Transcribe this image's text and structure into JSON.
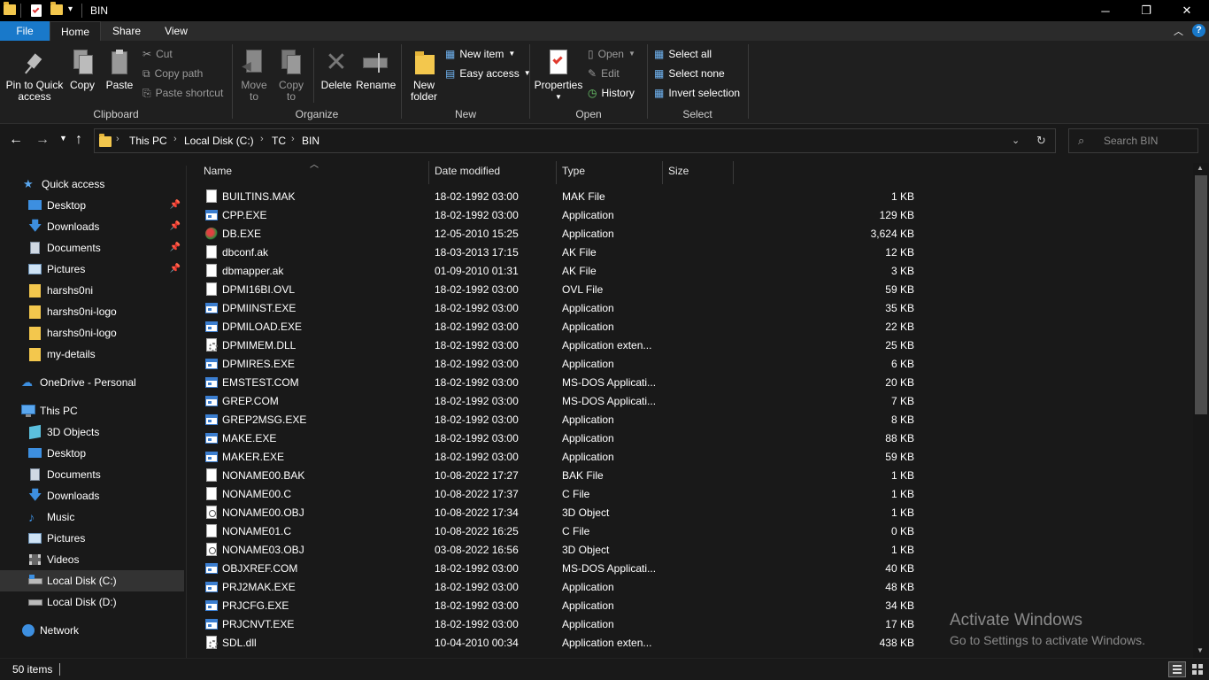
{
  "window": {
    "title": "BIN",
    "minimize": "─",
    "maximize": "❐",
    "close": "✕"
  },
  "ribbon_tabs": {
    "file": "File",
    "home": "Home",
    "share": "Share",
    "view": "View"
  },
  "ribbon": {
    "clipboard": {
      "group": "Clipboard",
      "pin_line1": "Pin to Quick",
      "pin_line2": "access",
      "copy": "Copy",
      "paste": "Paste",
      "cut": "Cut",
      "copy_path": "Copy path",
      "paste_shortcut": "Paste shortcut"
    },
    "organize": {
      "group": "Organize",
      "move_to_line1": "Move",
      "move_to_line2": "to",
      "copy_to_line1": "Copy",
      "copy_to_line2": "to",
      "delete": "Delete",
      "rename": "Rename"
    },
    "new": {
      "group": "New",
      "new_folder_line1": "New",
      "new_folder_line2": "folder",
      "new_item": "New item",
      "easy_access": "Easy access"
    },
    "open": {
      "group": "Open",
      "properties": "Properties",
      "open": "Open",
      "edit": "Edit",
      "history": "History"
    },
    "select": {
      "group": "Select",
      "select_all": "Select all",
      "select_none": "Select none",
      "invert_selection": "Invert selection"
    }
  },
  "address": {
    "crumbs": [
      "This PC",
      "Local Disk (C:)",
      "TC",
      "BIN"
    ],
    "search_placeholder": "Search BIN"
  },
  "sidebar": {
    "quick_access": "Quick access",
    "quick_items": [
      "Desktop",
      "Downloads",
      "Documents",
      "Pictures",
      "harshs0ni",
      "harshs0ni-logo",
      "harshs0ni-logo",
      "my-details"
    ],
    "onedrive": "OneDrive - Personal",
    "this_pc": "This PC",
    "pc_items": [
      "3D Objects",
      "Desktop",
      "Documents",
      "Downloads",
      "Music",
      "Pictures",
      "Videos",
      "Local Disk (C:)",
      "Local Disk (D:)"
    ],
    "network": "Network"
  },
  "columns": {
    "name": "Name",
    "date": "Date modified",
    "type": "Type",
    "size": "Size"
  },
  "files": [
    {
      "name": "BUILTINS.MAK",
      "date": "18-02-1992 03:00",
      "type": "MAK File",
      "size": "1 KB",
      "icon": "doc"
    },
    {
      "name": "CPP.EXE",
      "date": "18-02-1992 03:00",
      "type": "Application",
      "size": "129 KB",
      "icon": "app"
    },
    {
      "name": "DB.EXE",
      "date": "12-05-2010 15:25",
      "type": "Application",
      "size": "3,624 KB",
      "icon": "db"
    },
    {
      "name": "dbconf.ak",
      "date": "18-03-2013 17:15",
      "type": "AK File",
      "size": "12 KB",
      "icon": "doc"
    },
    {
      "name": "dbmapper.ak",
      "date": "01-09-2010 01:31",
      "type": "AK File",
      "size": "3 KB",
      "icon": "doc"
    },
    {
      "name": "DPMI16BI.OVL",
      "date": "18-02-1992 03:00",
      "type": "OVL File",
      "size": "59 KB",
      "icon": "doc"
    },
    {
      "name": "DPMIINST.EXE",
      "date": "18-02-1992 03:00",
      "type": "Application",
      "size": "35 KB",
      "icon": "app"
    },
    {
      "name": "DPMILOAD.EXE",
      "date": "18-02-1992 03:00",
      "type": "Application",
      "size": "22 KB",
      "icon": "app"
    },
    {
      "name": "DPMIMEM.DLL",
      "date": "18-02-1992 03:00",
      "type": "Application exten...",
      "size": "25 KB",
      "icon": "dll"
    },
    {
      "name": "DPMIRES.EXE",
      "date": "18-02-1992 03:00",
      "type": "Application",
      "size": "6 KB",
      "icon": "app"
    },
    {
      "name": "EMSTEST.COM",
      "date": "18-02-1992 03:00",
      "type": "MS-DOS Applicati...",
      "size": "20 KB",
      "icon": "app"
    },
    {
      "name": "GREP.COM",
      "date": "18-02-1992 03:00",
      "type": "MS-DOS Applicati...",
      "size": "7 KB",
      "icon": "app"
    },
    {
      "name": "GREP2MSG.EXE",
      "date": "18-02-1992 03:00",
      "type": "Application",
      "size": "8 KB",
      "icon": "app"
    },
    {
      "name": "MAKE.EXE",
      "date": "18-02-1992 03:00",
      "type": "Application",
      "size": "88 KB",
      "icon": "app"
    },
    {
      "name": "MAKER.EXE",
      "date": "18-02-1992 03:00",
      "type": "Application",
      "size": "59 KB",
      "icon": "app"
    },
    {
      "name": "NONAME00.BAK",
      "date": "10-08-2022 17:27",
      "type": "BAK File",
      "size": "1 KB",
      "icon": "doc"
    },
    {
      "name": "NONAME00.C",
      "date": "10-08-2022 17:37",
      "type": "C File",
      "size": "1 KB",
      "icon": "doc"
    },
    {
      "name": "NONAME00.OBJ",
      "date": "10-08-2022 17:34",
      "type": "3D Object",
      "size": "1 KB",
      "icon": "obj"
    },
    {
      "name": "NONAME01.C",
      "date": "10-08-2022 16:25",
      "type": "C File",
      "size": "0 KB",
      "icon": "doc"
    },
    {
      "name": "NONAME03.OBJ",
      "date": "03-08-2022 16:56",
      "type": "3D Object",
      "size": "1 KB",
      "icon": "obj"
    },
    {
      "name": "OBJXREF.COM",
      "date": "18-02-1992 03:00",
      "type": "MS-DOS Applicati...",
      "size": "40 KB",
      "icon": "app"
    },
    {
      "name": "PRJ2MAK.EXE",
      "date": "18-02-1992 03:00",
      "type": "Application",
      "size": "48 KB",
      "icon": "app"
    },
    {
      "name": "PRJCFG.EXE",
      "date": "18-02-1992 03:00",
      "type": "Application",
      "size": "34 KB",
      "icon": "app"
    },
    {
      "name": "PRJCNVT.EXE",
      "date": "18-02-1992 03:00",
      "type": "Application",
      "size": "17 KB",
      "icon": "app"
    },
    {
      "name": "SDL.dll",
      "date": "10-04-2010 00:34",
      "type": "Application exten...",
      "size": "438 KB",
      "icon": "dll"
    }
  ],
  "status": {
    "count": "50 items"
  },
  "watermark": {
    "line1": "Activate Windows",
    "line2": "Go to Settings to activate Windows."
  }
}
